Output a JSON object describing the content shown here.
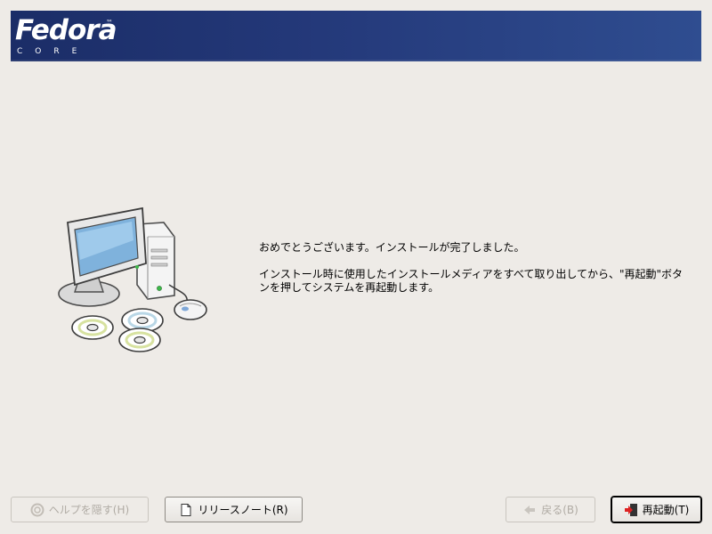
{
  "banner": {
    "logo_word": "Fedora",
    "logo_tm": "™",
    "logo_core": "CORE",
    "colors": {
      "banner": "#24397a",
      "background": "#eeebe7"
    }
  },
  "message": {
    "line1": "おめでとうございます。インストールが完了しました。",
    "line2": "インストール時に使用したインストールメディアをすべて取り出してから、\"再起動\"ボタンを押してシステムを再起動します。"
  },
  "buttons": {
    "help": {
      "label": "ヘルプを隠す(H)",
      "icon": "help-icon",
      "enabled": false
    },
    "release_notes": {
      "label": "リリースノート(R)",
      "icon": "document-icon",
      "enabled": true
    },
    "back": {
      "label": "戻る(B)",
      "icon": "back-arrow-icon",
      "enabled": false
    },
    "reboot": {
      "label": "再起動(T)",
      "icon": "exit-icon",
      "enabled": true
    }
  }
}
